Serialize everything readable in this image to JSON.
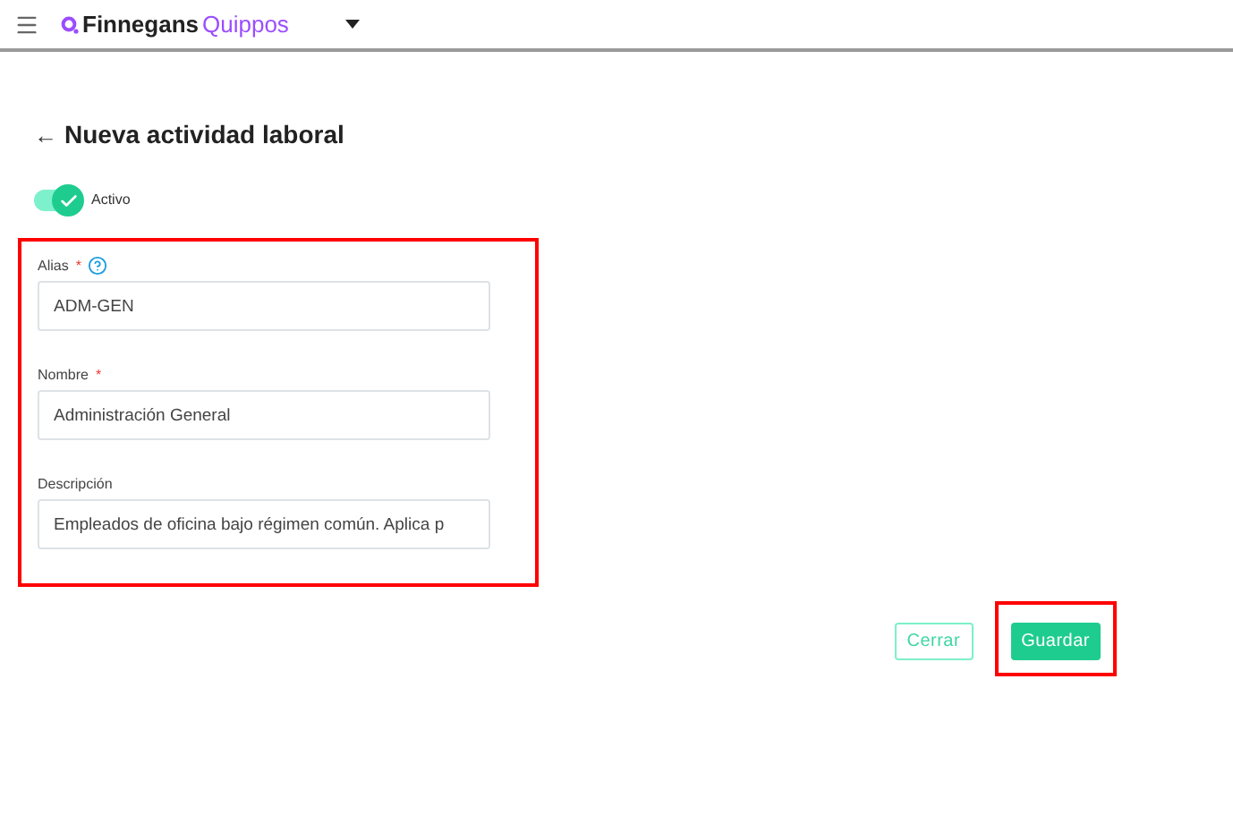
{
  "header": {
    "brand_first": "Finnegans",
    "brand_second": "Quippos"
  },
  "page": {
    "title": "Nueva actividad laboral",
    "back_arrow": "←"
  },
  "active_toggle": {
    "label": "Activo",
    "on": true
  },
  "form": {
    "highlighted": true,
    "fields": [
      {
        "label": "Alias",
        "required_mark": "*",
        "help": true,
        "value": "ADM-GEN"
      },
      {
        "label": "Nombre",
        "required_mark": "*",
        "help": false,
        "value": "Administración General"
      },
      {
        "label": "Descripción",
        "help": false,
        "value": "Empleados de oficina bajo régimen común. Aplica p"
      }
    ]
  },
  "buttons": [
    {
      "kind": "outline",
      "label": "Cerrar",
      "highlighted": false
    },
    {
      "kind": "primary",
      "label": "Guardar",
      "highlighted": true
    }
  ]
}
